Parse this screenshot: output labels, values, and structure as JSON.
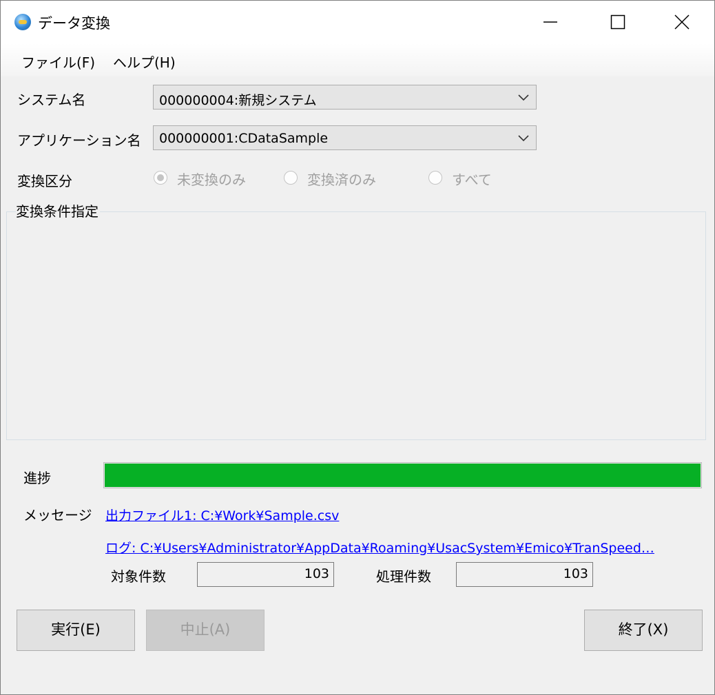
{
  "window": {
    "title": "データ変換"
  },
  "menu": {
    "items": [
      "ファイル(F)",
      "ヘルプ(H)"
    ]
  },
  "form": {
    "system_label": "システム名",
    "system_value": "000000004:新規システム",
    "application_label": "アプリケーション名",
    "application_value": "000000001:CDataSample",
    "conversion_type_label": "変換区分",
    "conversion_options": [
      "未変換のみ",
      "変換済のみ",
      "すべて"
    ],
    "conversion_selected": "未変換のみ",
    "conditions_group_title": "変換条件指定"
  },
  "progress": {
    "label": "進捗",
    "value_percent": 100,
    "color": "#06b025"
  },
  "messages": {
    "label": "メッセージ",
    "output_link": "出力ファイル1: C:¥Work¥Sample.csv",
    "log_link": "ログ: C:¥Users¥Administrator¥AppData¥Roaming¥UsacSystem¥Emico¥TranSpeed…"
  },
  "counts": {
    "target_label": "対象件数",
    "target_value": "103",
    "processed_label": "処理件数",
    "processed_value": "103"
  },
  "buttons": {
    "run": "実行(E)",
    "abort": "中止(A)",
    "exit": "終了(X)"
  }
}
